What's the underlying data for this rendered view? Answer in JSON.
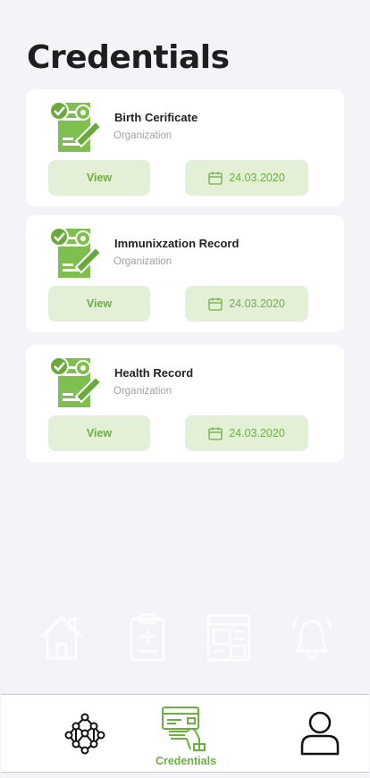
{
  "page": {
    "title": "Credentials"
  },
  "credentials": [
    {
      "title": "Birth Cerificate",
      "subtitle": "Organization",
      "view_label": "View",
      "date": "24.03.2020"
    },
    {
      "title": "Immunixzation Record",
      "subtitle": "Organization",
      "view_label": "View",
      "date": "24.03.2020"
    },
    {
      "title": "Health Record",
      "subtitle": "Organization",
      "view_label": "View",
      "date": "24.03.2020"
    }
  ],
  "faded_icons": [
    "home-icon",
    "clipboard-medical-icon",
    "browser-window-icon",
    "bell-icon"
  ],
  "bottom_nav": {
    "items": [
      {
        "icon": "network-icon",
        "label": ""
      },
      {
        "icon": "card-in-hand-icon",
        "label": "Credentials",
        "active": true
      },
      {
        "icon": "user-icon",
        "label": ""
      }
    ]
  },
  "colors": {
    "accent": "#6bb03f",
    "accent_light": "#e3efd7",
    "background": "#f3f4f7",
    "card": "#ffffff",
    "title_text": "#1e1e1e",
    "muted_text": "#a2a2a2"
  }
}
